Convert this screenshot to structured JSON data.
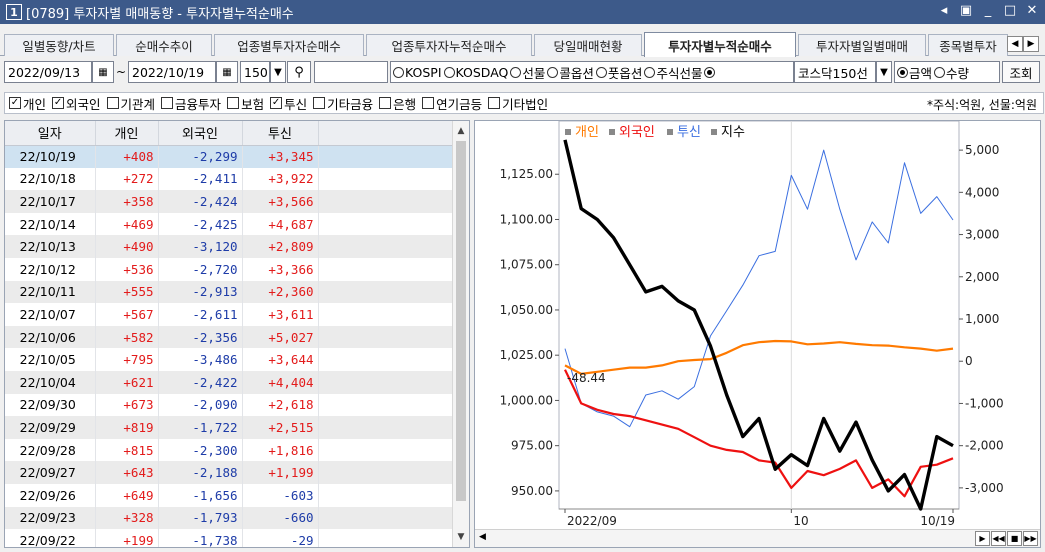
{
  "window": {
    "number": "1",
    "title": "[0789] 투자자별 매매동향 - 투자자별누적순매수"
  },
  "tabs": [
    "일별동향/차트",
    "순매수추이",
    "업종별투자자순매수",
    "업종투자자누적순매수",
    "당일매매현황",
    "투자자별누적순매수",
    "투자자별일별매매",
    "종목별투자"
  ],
  "active_tab": 5,
  "filters": {
    "start_date": "2022/09/13",
    "separator": "~",
    "end_date": "2022/10/19",
    "count": "150",
    "search_value": "",
    "markets": [
      {
        "label": "KOSPI",
        "checked": false
      },
      {
        "label": "KOSDAQ",
        "checked": false
      },
      {
        "label": "선물",
        "checked": false
      },
      {
        "label": "콜옵션",
        "checked": false
      },
      {
        "label": "풋옵션",
        "checked": false
      },
      {
        "label": "주식선물",
        "checked": true
      }
    ],
    "market_select": "코스닥150선",
    "measure": [
      {
        "label": "금액",
        "checked": true
      },
      {
        "label": "수량",
        "checked": false
      }
    ],
    "query_button": "조회"
  },
  "investors": [
    {
      "label": "개인",
      "checked": true
    },
    {
      "label": "외국인",
      "checked": true
    },
    {
      "label": "기관계",
      "checked": false
    },
    {
      "label": "금융투자",
      "checked": false
    },
    {
      "label": "보험",
      "checked": false
    },
    {
      "label": "투신",
      "checked": true
    },
    {
      "label": "기타금융",
      "checked": false
    },
    {
      "label": "은행",
      "checked": false
    },
    {
      "label": "연기금등",
      "checked": false
    },
    {
      "label": "기타법인",
      "checked": false
    }
  ],
  "unit_note": "*주식:억원, 선물:억원",
  "table": {
    "columns": [
      "일자",
      "개인",
      "외국인",
      "투신"
    ],
    "rows": [
      [
        "22/10/19",
        "+408",
        "-2,299",
        "+3,345"
      ],
      [
        "22/10/18",
        "+272",
        "-2,411",
        "+3,922"
      ],
      [
        "22/10/17",
        "+358",
        "-2,424",
        "+3,566"
      ],
      [
        "22/10/14",
        "+469",
        "-2,425",
        "+4,687"
      ],
      [
        "22/10/13",
        "+490",
        "-3,120",
        "+2,809"
      ],
      [
        "22/10/12",
        "+536",
        "-2,720",
        "+3,366"
      ],
      [
        "22/10/11",
        "+555",
        "-2,913",
        "+2,360"
      ],
      [
        "22/10/07",
        "+567",
        "-2,611",
        "+3,611"
      ],
      [
        "22/10/06",
        "+582",
        "-2,356",
        "+5,027"
      ],
      [
        "22/10/05",
        "+795",
        "-3,486",
        "+3,644"
      ],
      [
        "22/10/04",
        "+621",
        "-2,422",
        "+4,404"
      ],
      [
        "22/09/30",
        "+673",
        "-2,090",
        "+2,618"
      ],
      [
        "22/09/29",
        "+819",
        "-1,722",
        "+2,515"
      ],
      [
        "22/09/28",
        "+815",
        "-2,300",
        "+1,816"
      ],
      [
        "22/09/27",
        "+643",
        "-2,188",
        "+1,199"
      ],
      [
        "22/09/26",
        "+649",
        "-1,656",
        "-603"
      ],
      [
        "22/09/23",
        "+328",
        "-1,793",
        "-660"
      ],
      [
        "22/09/22",
        "+199",
        "-1,738",
        "-29"
      ]
    ]
  },
  "chart_data": {
    "type": "line",
    "legend": [
      "개인",
      "외국인",
      "투신",
      "지수"
    ],
    "colors": {
      "개인": "#ff7a00",
      "외국인": "#ee1111",
      "투신": "#3b6fe0",
      "지수": "#000000"
    },
    "x": [
      "09/13",
      "09/14",
      "09/15",
      "09/16",
      "09/19",
      "09/20",
      "09/21",
      "09/22",
      "09/23",
      "09/26",
      "09/27",
      "09/28",
      "09/29",
      "09/30",
      "10/04",
      "10/05",
      "10/06",
      "10/07",
      "10/11",
      "10/12",
      "10/13",
      "10/14",
      "10/17",
      "10/18",
      "10/19"
    ],
    "x_tick_labels": [
      "2022/09",
      "10",
      "10/19"
    ],
    "y_left": {
      "ticks": [
        "1,125.00",
        "1,100.00",
        "1,075.00",
        "1,050.00",
        "1,025.00",
        "1,000.00",
        "975.00",
        "950.00"
      ],
      "range": [
        940,
        1150
      ]
    },
    "y_right": {
      "ticks": [
        "5,000",
        "4,000",
        "3,000",
        "2,000",
        "1,000",
        "0",
        "-1,000",
        "-2,000",
        "-3,000"
      ],
      "range": [
        -3500,
        5500
      ]
    },
    "annotation": "-48.44",
    "series": [
      {
        "name": "지수",
        "axis": "left",
        "values": [
          1144,
          1106,
          1100,
          1090,
          1075,
          1060,
          1063,
          1055,
          1050,
          1030,
          1003,
          980,
          990,
          962,
          970,
          964,
          990,
          972,
          988,
          967,
          950,
          959,
          940,
          980,
          975
        ]
      },
      {
        "name": "개인",
        "axis": "right",
        "values": [
          -100,
          -300,
          -250,
          -200,
          -150,
          -150,
          -100,
          0,
          30,
          50,
          200,
          380,
          450,
          480,
          470,
          400,
          420,
          450,
          410,
          380,
          370,
          330,
          300,
          250,
          300
        ]
      },
      {
        "name": "외국인",
        "axis": "right",
        "values": [
          -200,
          -1000,
          -1150,
          -1250,
          -1300,
          -1400,
          -1500,
          -1600,
          -1800,
          -2000,
          -2100,
          -2150,
          -2350,
          -2400,
          -3000,
          -2600,
          -2700,
          -2550,
          -2350,
          -3000,
          -2800,
          -3200,
          -2500,
          -2450,
          -2299
        ]
      },
      {
        "name": "투신",
        "axis": "right",
        "values": [
          300,
          -1000,
          -1200,
          -1300,
          -1550,
          -800,
          -700,
          -900,
          -600,
          600,
          1200,
          1800,
          2500,
          2600,
          4400,
          3600,
          5000,
          3600,
          2400,
          3300,
          2800,
          4700,
          3500,
          3900,
          3345
        ]
      }
    ]
  }
}
